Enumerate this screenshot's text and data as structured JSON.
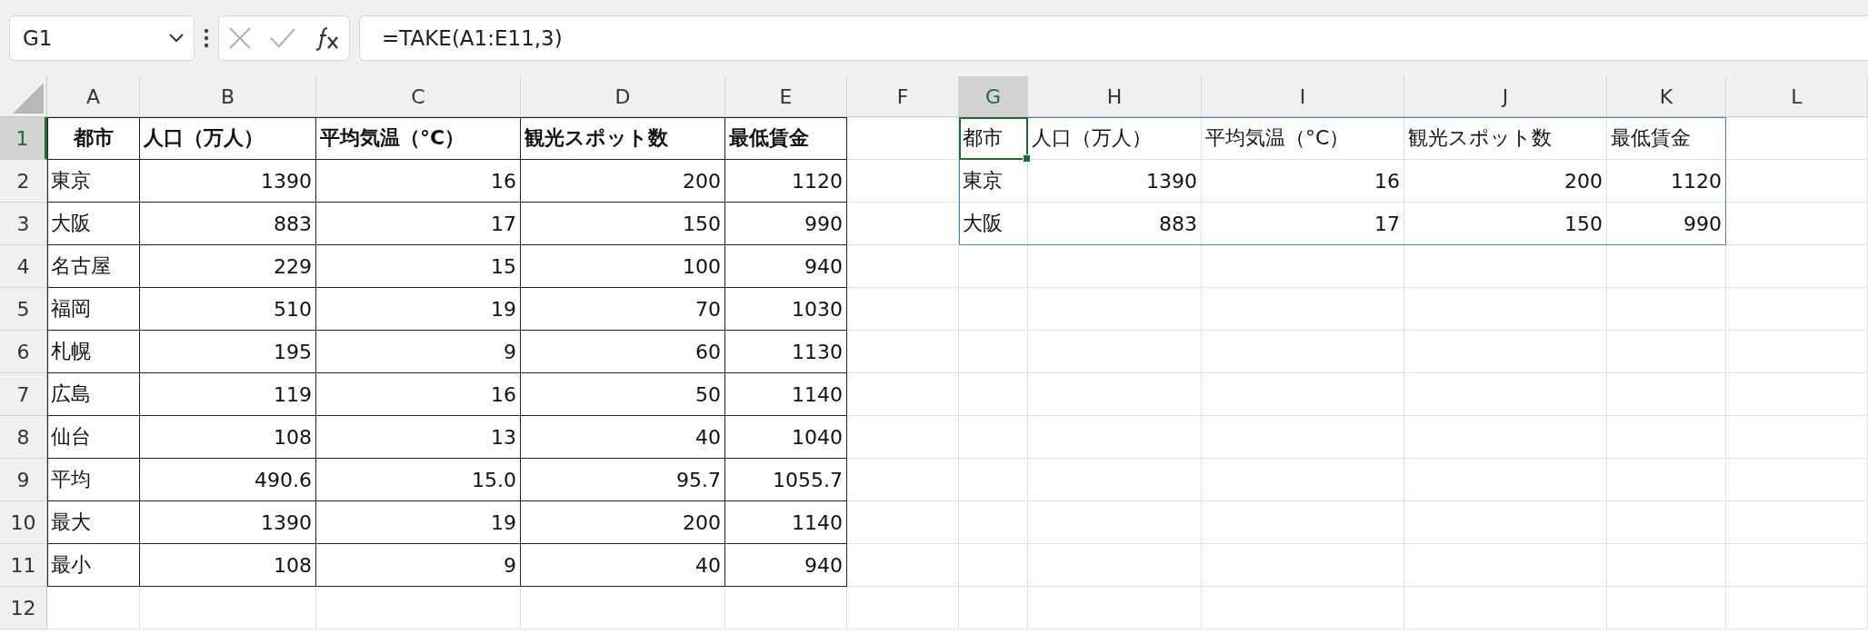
{
  "formula_bar": {
    "name_box": "G1",
    "formula": "=TAKE(A1:E11,3)"
  },
  "columns": [
    {
      "label": "A",
      "selected": false
    },
    {
      "label": "B",
      "selected": false
    },
    {
      "label": "C",
      "selected": false
    },
    {
      "label": "D",
      "selected": false
    },
    {
      "label": "E",
      "selected": false
    },
    {
      "label": "F",
      "selected": false
    },
    {
      "label": "G",
      "selected": true
    },
    {
      "label": "H",
      "selected": false
    },
    {
      "label": "I",
      "selected": false
    },
    {
      "label": "J",
      "selected": false
    },
    {
      "label": "K",
      "selected": false
    },
    {
      "label": "L",
      "selected": false
    }
  ],
  "rows": [
    {
      "label": "1",
      "selected": true
    },
    {
      "label": "2",
      "selected": false
    },
    {
      "label": "3",
      "selected": false
    },
    {
      "label": "4",
      "selected": false
    },
    {
      "label": "5",
      "selected": false
    },
    {
      "label": "6",
      "selected": false
    },
    {
      "label": "7",
      "selected": false
    },
    {
      "label": "8",
      "selected": false
    },
    {
      "label": "9",
      "selected": false
    },
    {
      "label": "10",
      "selected": false
    },
    {
      "label": "11",
      "selected": false
    },
    {
      "label": "12",
      "selected": false
    }
  ],
  "source_table": {
    "header": [
      "都市",
      "人口（万人）",
      "平均気温（°C）",
      "観光スポット数",
      "最低賃金"
    ],
    "rows": [
      [
        "東京",
        "1390",
        "16",
        "200",
        "1120"
      ],
      [
        "大阪",
        "883",
        "17",
        "150",
        "990"
      ],
      [
        "名古屋",
        "229",
        "15",
        "100",
        "940"
      ],
      [
        "福岡",
        "510",
        "19",
        "70",
        "1030"
      ],
      [
        "札幌",
        "195",
        "9",
        "60",
        "1130"
      ],
      [
        "広島",
        "119",
        "16",
        "50",
        "1140"
      ],
      [
        "仙台",
        "108",
        "13",
        "40",
        "1040"
      ],
      [
        "平均",
        "490.6",
        "15.0",
        "95.7",
        "1055.7"
      ],
      [
        "最大",
        "1390",
        "19",
        "200",
        "1140"
      ],
      [
        "最小",
        "108",
        "9",
        "40",
        "940"
      ]
    ]
  },
  "spill_table": {
    "header": [
      "都市",
      "人口（万人）",
      "平均気温（°C）",
      "観光スポット数",
      "最低賃金"
    ],
    "rows": [
      [
        "東京",
        "1390",
        "16",
        "200",
        "1120"
      ],
      [
        "大阪",
        "883",
        "17",
        "150",
        "990"
      ]
    ]
  }
}
